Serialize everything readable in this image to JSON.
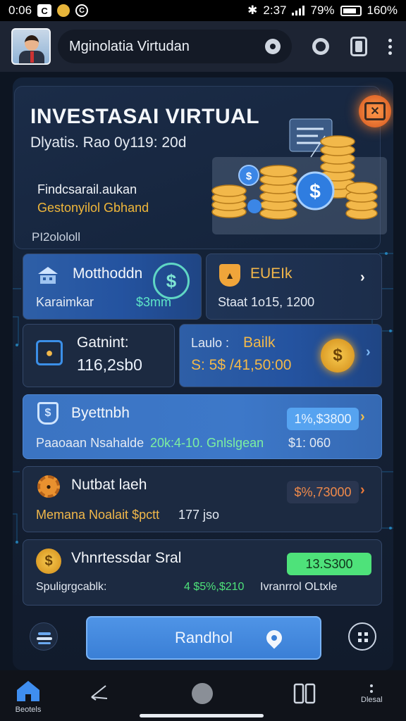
{
  "status_bar": {
    "time": "0:06",
    "chip_letter": "C",
    "c_icon": "C",
    "right_text": "2:37",
    "battery_pct": "79%",
    "speed": "160%"
  },
  "header": {
    "url": "Mginolatia Virtudan"
  },
  "hero": {
    "title": "INVESTASAI VIRTUAL",
    "subtitle": "Dlyatis. Rao 0y119: 20d",
    "line1": "Findcsarail.aukan",
    "line2": "Gestonyilol Gbhand",
    "line3": "PI2olololl"
  },
  "cards": {
    "motthodon": {
      "title": "Motthoddn",
      "sub": "Karaimkar",
      "value": "$3mm"
    },
    "euelk": {
      "title": "EUEIk",
      "sub": "Staat 1o15, 1200"
    },
    "gatnint": {
      "title": "Gatnint:",
      "value": "116,2sb0"
    },
    "balik": {
      "prefix": "Laulo :",
      "title": "Bailk",
      "value": "S: 5$ /41,50:00"
    },
    "byettnbh": {
      "title": "Byettnbh",
      "desc_a": "Paaoaan Nsahalde",
      "desc_b": "20k:4-10. Gnlslgean",
      "right": "$1: 060",
      "pill": "1%,$3800"
    },
    "nutbat": {
      "title": "Nutbat laeh",
      "desc_a": "Memana Noalait $pctt",
      "desc_b": "177 jso",
      "pill": "$%,73000"
    },
    "vhnrtessdar": {
      "title": "Vhnrtessdar Sral",
      "desc_a": "Spuligrgcablk:",
      "desc_b": "4 $5%,$210",
      "desc_c": "Ivranrrol OLtxle",
      "pill": "13.S300"
    }
  },
  "action": {
    "label": "Randhol"
  },
  "nav": {
    "home_label": "Beotels",
    "more_label": "Dlesal"
  },
  "colors": {
    "accent_blue": "#3a7fd6",
    "gold": "#f0b73a",
    "green": "#4ee27a",
    "orange": "#ee7a3a"
  }
}
